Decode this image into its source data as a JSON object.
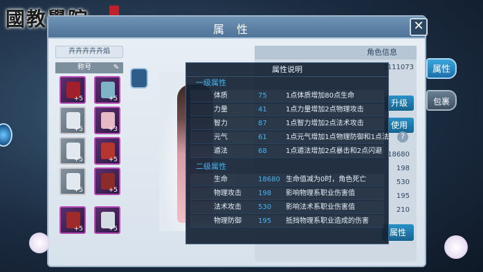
{
  "logo": {
    "text": "國教學院",
    "seal_text": "天堂"
  },
  "window": {
    "title": "属性",
    "close_icon": "✕"
  },
  "left_panel": {
    "player_name": "卉卉卉卉卉焰",
    "title_label": "称号",
    "slots": [
      {
        "name": "weapon",
        "level": "+5"
      },
      {
        "name": "helmet",
        "level": "+5"
      },
      {
        "name": "bracer",
        "level": "+5"
      },
      {
        "name": "necklace",
        "level": "+3"
      },
      {
        "name": "pants",
        "level": "+5"
      },
      {
        "name": "ring",
        "level": "+5"
      },
      {
        "name": "boots",
        "level": "+5"
      },
      {
        "name": "amulet",
        "level": "+5"
      },
      {
        "name": "spear",
        "level": "+5"
      },
      {
        "name": "armor",
        "level": "+5"
      }
    ]
  },
  "right_panel": {
    "header": "角色信息",
    "id_text": "3111073",
    "upgrade_button": "升级",
    "use_button": "使用",
    "values": [
      "18680",
      "198",
      "530",
      "195",
      "210"
    ],
    "bottom_button": "属性"
  },
  "side_tabs": {
    "attributes": "属性",
    "bag": "包裹"
  },
  "tooltip": {
    "title": "属性说明",
    "section1_title": "一级属性",
    "section1_rows": [
      {
        "name": "体质",
        "value": "75",
        "desc": "1点体质增加80点生命"
      },
      {
        "name": "力量",
        "value": "41",
        "desc": "1点力量增加2点物理攻击"
      },
      {
        "name": "智力",
        "value": "87",
        "desc": "1点智力增加2点法术攻击"
      },
      {
        "name": "元气",
        "value": "61",
        "desc": "1点元气增加1点物理防御和1点法"
      },
      {
        "name": "遁法",
        "value": "68",
        "desc": "1点遁法增加2点暴击和2点闪避"
      }
    ],
    "section2_title": "二级属性",
    "section2_rows": [
      {
        "name": "生命",
        "value": "18680",
        "desc": "生命值减为0时，角色死亡"
      },
      {
        "name": "物理攻击",
        "value": "198",
        "desc": "影响物理系职业伤害值"
      },
      {
        "name": "法术攻击",
        "value": "530",
        "desc": "影响法术系职业伤害值"
      },
      {
        "name": "物理防御",
        "value": "195",
        "desc": "抵挡物理系职业造成的伤害"
      }
    ]
  },
  "colors": {
    "accent": "#46b4f0",
    "tooltip_bg": "#142234",
    "slot_border": "#b64cb4"
  }
}
